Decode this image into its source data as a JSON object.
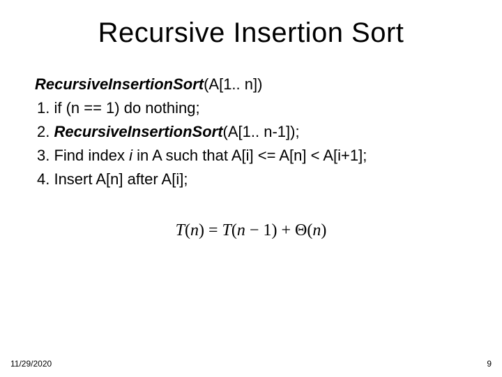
{
  "title": "Recursive Insertion Sort",
  "content": {
    "line0_bold": "RecursiveInsertionSort",
    "line0_rest": "(A[1.. n])",
    "line1": "1. if (n == 1) do nothing;",
    "line2_prefix": "2. ",
    "line2_bold": "RecursiveInsertionSort",
    "line2_rest": "(A[1.. n-1]);",
    "line3_a": "3. Find index ",
    "line3_i": "i",
    "line3_b": " in A such that A[i] <= A[n] < A[i+1];",
    "line4": "4. Insert A[n] after A[i];"
  },
  "equation": {
    "T1": "T",
    "lp1": "(",
    "n1": "n",
    "rp1": ")",
    "eq": " = ",
    "T2": "T",
    "lp2": "(",
    "n2": "n",
    "minus": " − 1",
    "rp2": ")",
    "plus": " + ",
    "theta": "Θ",
    "lp3": "(",
    "n3": "n",
    "rp3": ")"
  },
  "footer": {
    "date": "11/29/2020",
    "page": "9"
  }
}
